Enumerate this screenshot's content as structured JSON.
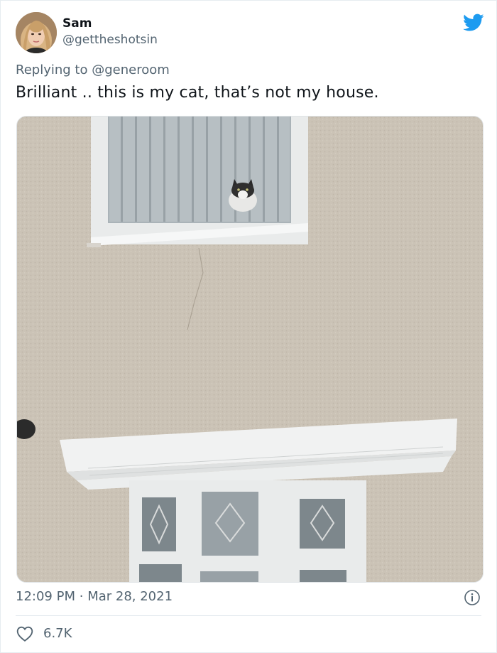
{
  "tweet": {
    "author": {
      "name": "Sam",
      "handle": "@gettheshotsin"
    },
    "reply": {
      "prefix": "Replying to",
      "to": "@generoom"
    },
    "text": "Brilliant .. this is my cat, that’s not my house.",
    "meta": {
      "time": "12:09 PM",
      "separator": "·",
      "date": "Mar 28, 2021"
    },
    "likes": "6.7K"
  },
  "icons": {
    "brand": "twitter-bird-icon",
    "info": "info-icon",
    "like": "heart-icon"
  },
  "colors": {
    "brand": "#1d9bf0",
    "secondary_text": "#536471",
    "primary_text": "#0f1419",
    "divider": "#e1e8ed"
  }
}
